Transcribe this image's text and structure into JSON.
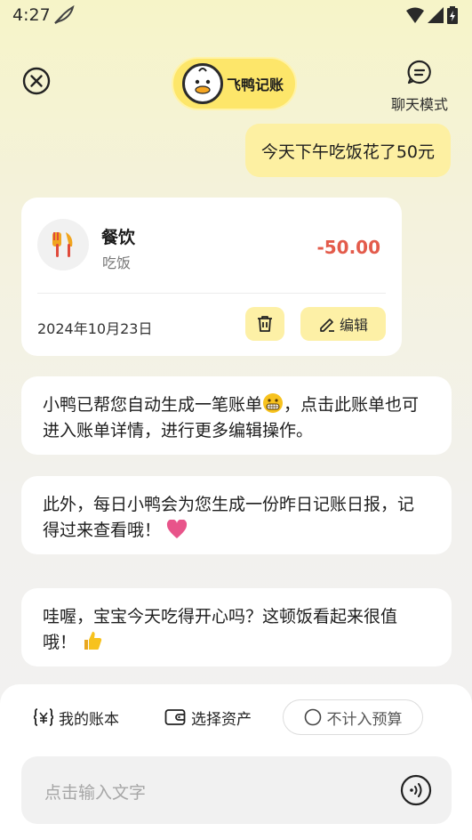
{
  "status_bar": {
    "time": "4:27"
  },
  "header": {
    "logo_text": "飞鸭记账",
    "chat_mode_label": "聊天模式"
  },
  "user_message": "今天下午吃饭花了50元",
  "bill_card": {
    "category": "餐饮",
    "note": "吃饭",
    "amount": "-50.00",
    "date": "2024年10月23日",
    "edit_label": "编辑",
    "amount_color": "#e35b4b"
  },
  "assistant_messages": [
    {
      "before_emoji": "小鸭已帮您自动生成一笔账单",
      "emoji": "grinning-face-icon",
      "after_emoji": "，点击此账单也可进入账单详情，进行更多编辑操作。"
    },
    {
      "text": "此外，每日小鸭会为您生成一份昨日记账日报，记得过来查看哦！",
      "emoji": "heart-icon"
    },
    {
      "text": "哇喔，宝宝今天吃得开心吗？这顿饭看起来很值哦！",
      "emoji": "thumbs-up-icon"
    }
  ],
  "bottom": {
    "my_ledger_label": "我的账本",
    "select_asset_label": "选择资产",
    "no_budget_label": "不计入预算",
    "input_placeholder": "点击输入文字"
  },
  "colors": {
    "accent_yellow": "#fde66a",
    "bubble_yellow": "#fdf0a2"
  }
}
